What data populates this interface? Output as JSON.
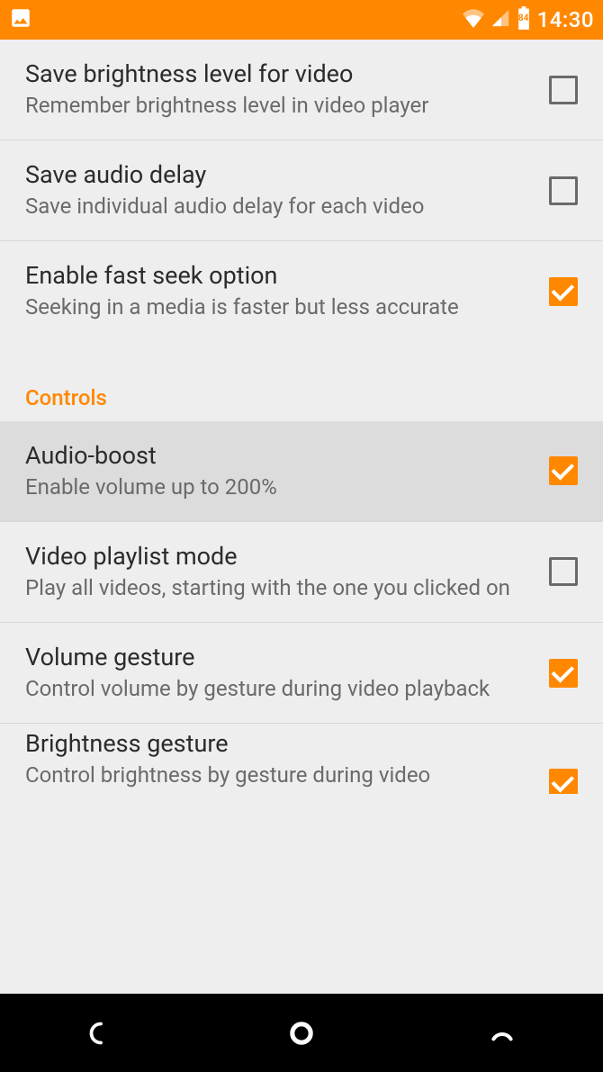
{
  "status": {
    "time": "14:30",
    "battery": "84"
  },
  "settings": [
    {
      "title": "Save brightness level for video",
      "sub": "Remember brightness level in video player",
      "checked": false,
      "highlight": false
    },
    {
      "title": "Save audio delay",
      "sub": "Save individual audio delay for each video",
      "checked": false,
      "highlight": false
    },
    {
      "title": "Enable fast seek option",
      "sub": "Seeking in a media is faster but less accurate",
      "checked": true,
      "highlight": false
    }
  ],
  "section": "Controls",
  "settings2": [
    {
      "title": "Audio-boost",
      "sub": "Enable volume up to 200%",
      "checked": true,
      "highlight": true
    },
    {
      "title": "Video playlist mode",
      "sub": "Play all videos, starting with the one you clicked on",
      "checked": false,
      "highlight": false
    },
    {
      "title": "Volume gesture",
      "sub": "Control volume by gesture during video playback",
      "checked": true,
      "highlight": false
    },
    {
      "title": "Brightness gesture",
      "sub": "Control brightness by gesture during video",
      "checked": true,
      "highlight": false
    }
  ]
}
